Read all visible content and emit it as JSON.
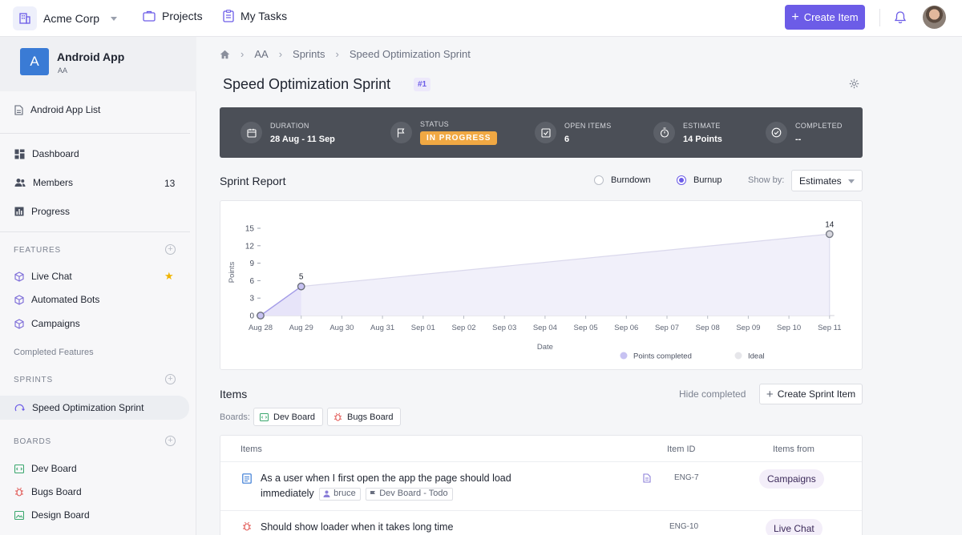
{
  "topbar": {
    "org_name": "Acme Corp",
    "projects_label": "Projects",
    "tasks_label": "My Tasks",
    "create_label": "Create Item"
  },
  "sidebar": {
    "project_initial": "A",
    "project_name": "Android App",
    "project_key": "AA",
    "list_label": "Android App List",
    "nav": [
      {
        "label": "Dashboard"
      },
      {
        "label": "Members",
        "count": "13"
      },
      {
        "label": "Progress"
      }
    ],
    "features_heading": "FEATURES",
    "features": [
      "Live Chat",
      "Automated Bots",
      "Campaigns"
    ],
    "completed_features": "Completed Features",
    "sprints_heading": "SPRINTS",
    "sprints": [
      "Speed Optimization Sprint"
    ],
    "boards_heading": "BOARDS",
    "boards": [
      "Dev Board",
      "Bugs Board",
      "Design Board"
    ]
  },
  "breadcrumb": [
    "AA",
    "Sprints",
    "Speed Optimization Sprint"
  ],
  "page": {
    "title": "Speed Optimization Sprint",
    "badge": "#1"
  },
  "stats": {
    "duration_label": "DURATION",
    "duration_value": "28 Aug - 11 Sep",
    "status_label": "STATUS",
    "status_value": "IN PROGRESS",
    "open_label": "OPEN ITEMS",
    "open_value": "6",
    "estimate_label": "ESTIMATE",
    "estimate_value": "14 Points",
    "completed_label": "COMPLETED",
    "completed_value": "--"
  },
  "report": {
    "title": "Sprint Report",
    "option_burndown": "Burndown",
    "option_burnup": "Burnup",
    "selected_option": "Burnup",
    "show_by_label": "Show by:",
    "show_by_value": "Estimates"
  },
  "chart_data": {
    "type": "line",
    "x": [
      "Aug 28",
      "Aug 29",
      "Aug 30",
      "Aug 31",
      "Sep 01",
      "Sep 02",
      "Sep 03",
      "Sep 04",
      "Sep 05",
      "Sep 06",
      "Sep 07",
      "Sep 08",
      "Sep 09",
      "Sep 10",
      "Sep 11"
    ],
    "xlabel": "Date",
    "ylabel": "Points",
    "ylim": [
      0,
      15
    ],
    "yticks": [
      0,
      3,
      6,
      9,
      12,
      15
    ],
    "series": [
      {
        "name": "Points completed",
        "color": "#6c5ce7",
        "points": [
          {
            "x": "Aug 28",
            "y": 0
          },
          {
            "x": "Aug 29",
            "y": 5
          }
        ]
      },
      {
        "name": "Ideal",
        "color": "#c9c9d6",
        "points": [
          {
            "x": "Aug 28",
            "y": 0
          },
          {
            "x": "Aug 29",
            "y": 5
          },
          {
            "x": "Sep 11",
            "y": 14
          }
        ]
      }
    ],
    "data_labels": [
      {
        "x": "Aug 29",
        "y": 5,
        "text": "5"
      },
      {
        "x": "Sep 11",
        "y": 14,
        "text": "14"
      }
    ],
    "legend": [
      "Points completed",
      "Ideal"
    ],
    "legend_position": "bottom-right",
    "grid": false
  },
  "items": {
    "title": "Items",
    "hide_completed": "Hide completed",
    "create_label": "Create Sprint Item",
    "boards_label": "Boards:",
    "boards": [
      "Dev Board",
      "Bugs Board"
    ],
    "columns": [
      "Items",
      "Item ID",
      "Items from"
    ],
    "rows": [
      {
        "title_line1": "As a user when I first open the app the page should load",
        "title_line2": "immediately",
        "assignee": "bruce",
        "location": "Dev Board - Todo",
        "id": "ENG-7",
        "from": "Campaigns"
      },
      {
        "title_line1": "Should show loader when it takes long time",
        "id": "ENG-10",
        "from": "Live Chat"
      }
    ]
  },
  "colors": {
    "accent": "#6c5ce7",
    "status": "#f0a843",
    "statbar": "#4b4f57"
  }
}
